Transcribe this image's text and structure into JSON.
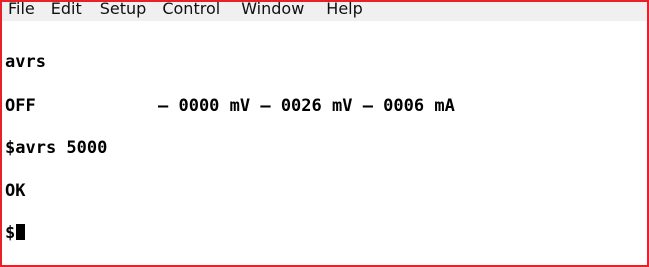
{
  "menu": {
    "items": [
      "File",
      "Edit",
      "Setup",
      "Control",
      "Window",
      "Help"
    ]
  },
  "terminal": {
    "lines": [
      "avrs",
      "OFF",
      "$avrs 5000",
      "OK",
      "$"
    ],
    "readings": "– 0000 mV – 0026 mV – 0006 mA"
  }
}
